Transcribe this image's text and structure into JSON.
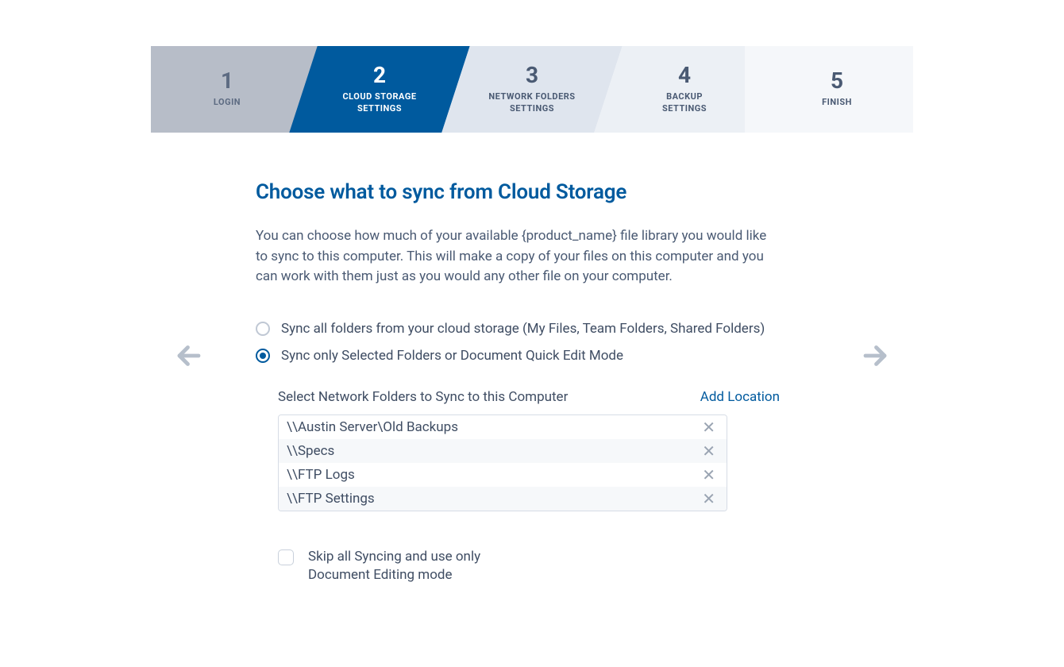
{
  "stepper": [
    {
      "num": "1",
      "label": "LOGIN"
    },
    {
      "num": "2",
      "label": "CLOUD STORAGE\nSETTINGS"
    },
    {
      "num": "3",
      "label": "NETWORK FOLDERS\nSETTINGS"
    },
    {
      "num": "4",
      "label": "BACKUP\nSETTINGS"
    },
    {
      "num": "5",
      "label": "FINISH"
    }
  ],
  "heading": "Choose what to sync from Cloud Storage",
  "description": "You can choose how much of your available {product_name} file library you would like to sync to this computer. This will make a copy of your files on this computer and you can work with them just as you would any other file on your computer.",
  "radios": {
    "all": "Sync all folders from your cloud storage (My Files, Team Folders, Shared Folders)",
    "selected": "Sync only Selected Folders or Document Quick Edit Mode"
  },
  "subpanel": {
    "title": "Select Network Folders to Sync to this Computer",
    "add_link": "Add Location",
    "folders": [
      "\\\\Austin Server\\Old Backups",
      "\\\\Specs",
      "\\\\FTP Logs",
      "\\\\FTP Settings"
    ]
  },
  "skip_label": "Skip all Syncing and use only Document Editing mode"
}
